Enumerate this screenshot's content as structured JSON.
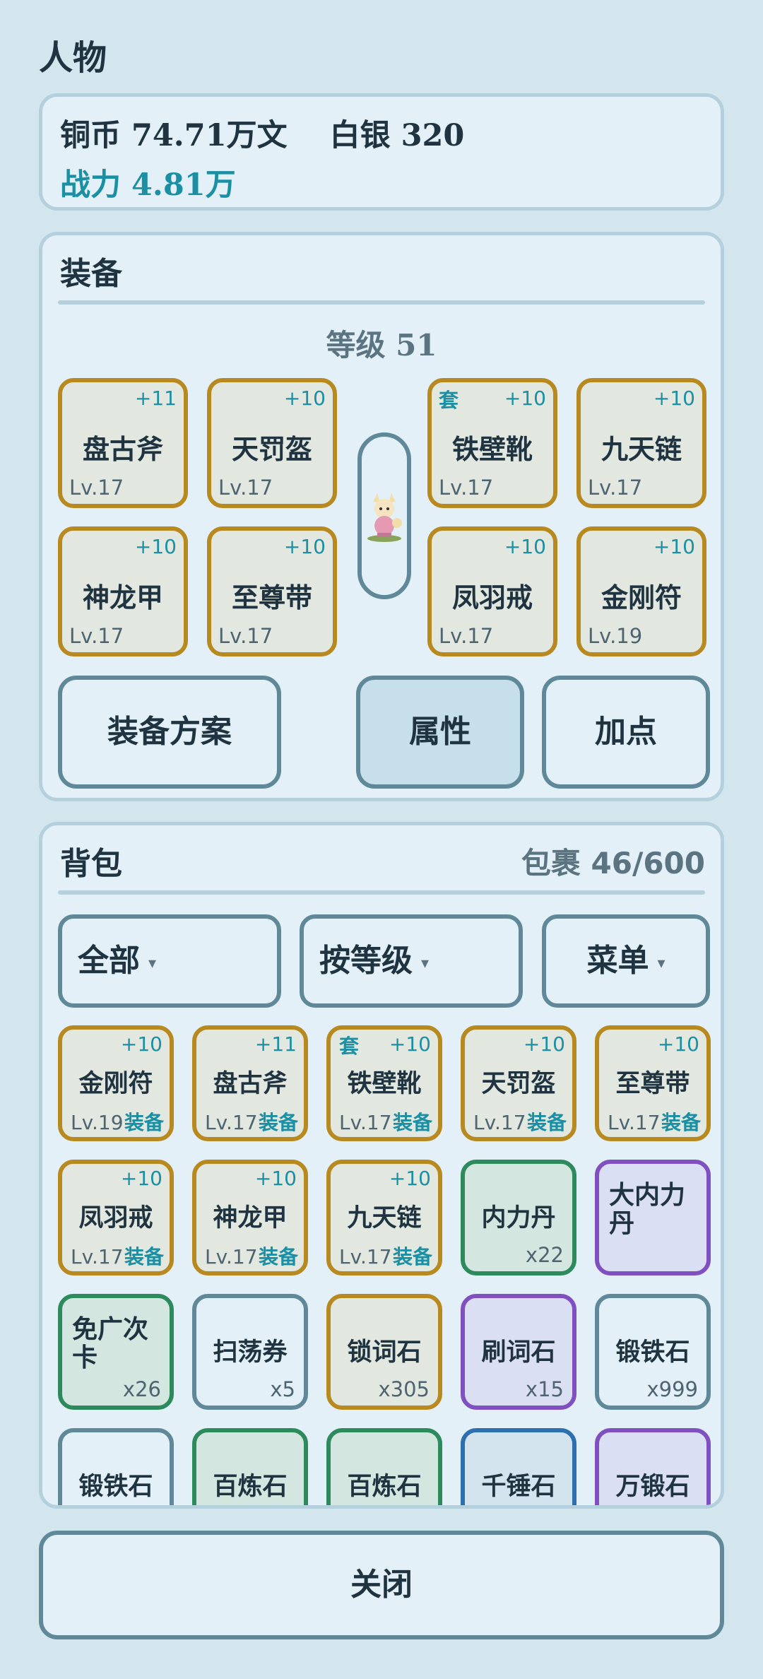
{
  "page_title": "人物",
  "currency": {
    "copper": "铜币 74.71万文",
    "silver": "白银 320",
    "power": "战力 4.81万"
  },
  "equipment": {
    "title": "装备",
    "level": "等级 51",
    "slots": [
      {
        "name": "盘古斧",
        "plus": "+11",
        "level": "Lv.17",
        "set": ""
      },
      {
        "name": "天罚盔",
        "plus": "+10",
        "level": "Lv.17",
        "set": ""
      },
      {
        "name": "铁壁靴",
        "plus": "+10",
        "level": "Lv.17",
        "set": "套"
      },
      {
        "name": "九天链",
        "plus": "+10",
        "level": "Lv.17",
        "set": ""
      },
      {
        "name": "神龙甲",
        "plus": "+10",
        "level": "Lv.17",
        "set": ""
      },
      {
        "name": "至尊带",
        "plus": "+10",
        "level": "Lv.17",
        "set": ""
      },
      {
        "name": "凤羽戒",
        "plus": "+10",
        "level": "Lv.17",
        "set": ""
      },
      {
        "name": "金刚符",
        "plus": "+10",
        "level": "Lv.19",
        "set": ""
      }
    ],
    "buttons": {
      "plan": "装备方案",
      "attributes": "属性",
      "points": "加点"
    }
  },
  "bag": {
    "title": "背包",
    "capacity": "包裹 46/600",
    "filters": {
      "category": "全部",
      "sort": "按等级",
      "menu": "菜单",
      "arrow": "▾"
    },
    "equipped_label": "装备",
    "items": [
      {
        "name": "金刚符",
        "plus": "+10",
        "level": "Lv.19",
        "set": "",
        "equipped": true,
        "rarity": "gold"
      },
      {
        "name": "盘古斧",
        "plus": "+11",
        "level": "Lv.17",
        "set": "",
        "equipped": true,
        "rarity": "gold"
      },
      {
        "name": "铁壁靴",
        "plus": "+10",
        "level": "Lv.17",
        "set": "套",
        "equipped": true,
        "rarity": "gold"
      },
      {
        "name": "天罚盔",
        "plus": "+10",
        "level": "Lv.17",
        "set": "",
        "equipped": true,
        "rarity": "gold"
      },
      {
        "name": "至尊带",
        "plus": "+10",
        "level": "Lv.17",
        "set": "",
        "equipped": true,
        "rarity": "gold"
      },
      {
        "name": "凤羽戒",
        "plus": "+10",
        "level": "Lv.17",
        "set": "",
        "equipped": true,
        "rarity": "gold"
      },
      {
        "name": "神龙甲",
        "plus": "+10",
        "level": "Lv.17",
        "set": "",
        "equipped": true,
        "rarity": "gold"
      },
      {
        "name": "九天链",
        "plus": "+10",
        "level": "Lv.17",
        "set": "",
        "equipped": true,
        "rarity": "gold"
      },
      {
        "name": "内力丹",
        "count": "x22",
        "rarity": "green"
      },
      {
        "name": "大内力丹",
        "count": "",
        "rarity": "purple",
        "wrap": true
      },
      {
        "name": "免广次卡",
        "count": "x26",
        "rarity": "green",
        "wrap": true
      },
      {
        "name": "扫荡券",
        "count": "x5",
        "rarity": "white"
      },
      {
        "name": "锁词石",
        "count": "x305",
        "rarity": "gold"
      },
      {
        "name": "刷词石",
        "count": "x15",
        "rarity": "purple"
      },
      {
        "name": "锻铁石",
        "count": "x999",
        "rarity": "white"
      },
      {
        "name": "锻铁石",
        "count": "",
        "rarity": "white"
      },
      {
        "name": "百炼石",
        "count": "",
        "rarity": "green"
      },
      {
        "name": "百炼石",
        "count": "",
        "rarity": "green"
      },
      {
        "name": "千锤石",
        "count": "",
        "rarity": "blue"
      },
      {
        "name": "万锻石",
        "count": "",
        "rarity": "purple"
      }
    ]
  },
  "close_label": "关闭",
  "colors": {
    "background": "#d3e6ee",
    "panel": "#e3f0f7",
    "gold_border": "#b7891f",
    "green_border": "#2d8a5c",
    "purple_border": "#8050c0",
    "accent": "#1b8fa3"
  }
}
